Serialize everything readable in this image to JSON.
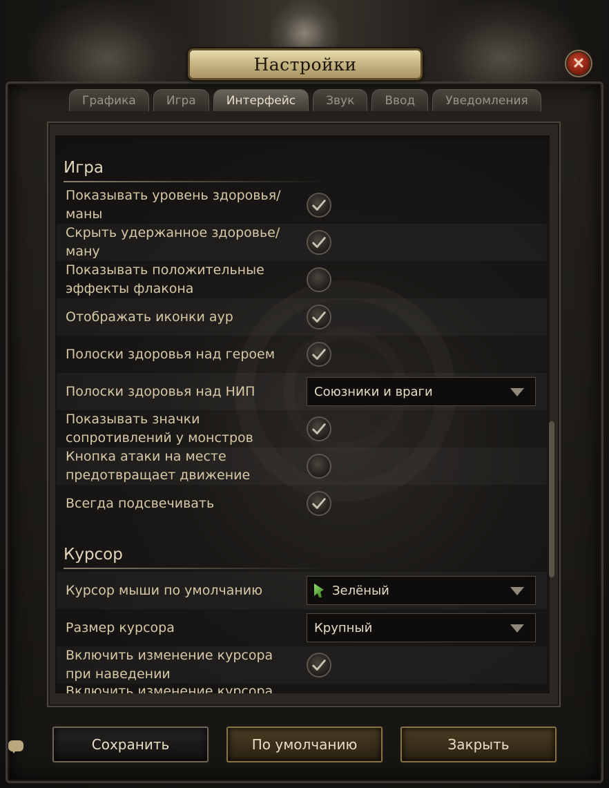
{
  "window": {
    "title": "Настройки",
    "close_symbol": "✕"
  },
  "tabs": [
    {
      "label": "Графика"
    },
    {
      "label": "Игра"
    },
    {
      "label": "Интерфейс",
      "active": true
    },
    {
      "label": "Звук"
    },
    {
      "label": "Ввод"
    },
    {
      "label": "Уведомления"
    }
  ],
  "sections": {
    "game": {
      "title": "Игра"
    },
    "cursor": {
      "title": "Курсор"
    }
  },
  "game_settings": [
    {
      "label": "Показывать уровень здоровья/маны",
      "type": "checkbox",
      "checked": true
    },
    {
      "label": "Скрыть удержанное здоровье/ману",
      "type": "checkbox",
      "checked": true
    },
    {
      "label": "Показывать положительные эффекты флакона",
      "type": "checkbox",
      "checked": false
    },
    {
      "label": "Отображать иконки аур",
      "type": "checkbox",
      "checked": true
    },
    {
      "label": "Полоски здоровья над героем",
      "type": "checkbox",
      "checked": true
    },
    {
      "label": "Полоски здоровья над НИП",
      "type": "dropdown",
      "value": "Союзники и враги"
    },
    {
      "label": "Показывать значки сопротивлений у монстров",
      "type": "checkbox",
      "checked": true
    },
    {
      "label": "Кнопка атаки на месте предотвращает движение",
      "type": "checkbox",
      "checked": false
    },
    {
      "label": "Всегда подсвечивать",
      "type": "checkbox",
      "checked": true
    }
  ],
  "cursor_settings": [
    {
      "label": "Курсор мыши по умолчанию",
      "type": "dropdown",
      "value": "Зелёный",
      "icon": "green-cursor-icon"
    },
    {
      "label": "Размер курсора",
      "type": "dropdown",
      "value": "Крупный"
    },
    {
      "label": "Включить изменение курсора при наведении",
      "type": "checkbox",
      "checked": true
    },
    {
      "label": "Включить изменение курсора",
      "type": "checkbox",
      "checked": true
    }
  ],
  "footer": {
    "save_label": "Сохранить",
    "default_label": "По умолчанию",
    "close_label": "Закрыть"
  },
  "colors": {
    "accent": "#c9b885",
    "text": "#d7c8a6",
    "close_button": "#b33a22"
  }
}
